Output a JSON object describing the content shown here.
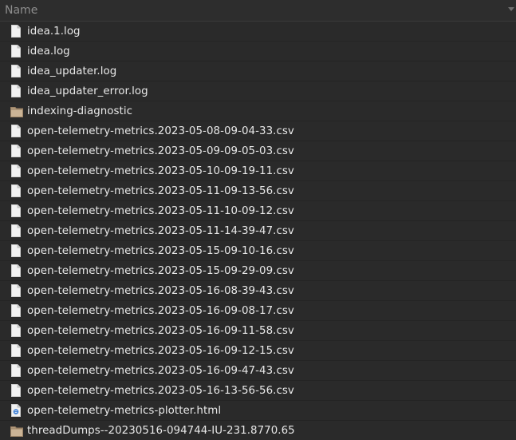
{
  "header": {
    "name_label": "Name"
  },
  "files": [
    {
      "name": "idea.1.log",
      "icon": "file-icon"
    },
    {
      "name": "idea.log",
      "icon": "file-icon"
    },
    {
      "name": "idea_updater.log",
      "icon": "file-icon"
    },
    {
      "name": "idea_updater_error.log",
      "icon": "file-icon"
    },
    {
      "name": "indexing-diagnostic",
      "icon": "folder-icon"
    },
    {
      "name": "open-telemetry-metrics.2023-05-08-09-04-33.csv",
      "icon": "file-icon"
    },
    {
      "name": "open-telemetry-metrics.2023-05-09-09-05-03.csv",
      "icon": "file-icon"
    },
    {
      "name": "open-telemetry-metrics.2023-05-10-09-19-11.csv",
      "icon": "file-icon"
    },
    {
      "name": "open-telemetry-metrics.2023-05-11-09-13-56.csv",
      "icon": "file-icon"
    },
    {
      "name": "open-telemetry-metrics.2023-05-11-10-09-12.csv",
      "icon": "file-icon"
    },
    {
      "name": "open-telemetry-metrics.2023-05-11-14-39-47.csv",
      "icon": "file-icon"
    },
    {
      "name": "open-telemetry-metrics.2023-05-15-09-10-16.csv",
      "icon": "file-icon"
    },
    {
      "name": "open-telemetry-metrics.2023-05-15-09-29-09.csv",
      "icon": "file-icon"
    },
    {
      "name": "open-telemetry-metrics.2023-05-16-08-39-43.csv",
      "icon": "file-icon"
    },
    {
      "name": "open-telemetry-metrics.2023-05-16-09-08-17.csv",
      "icon": "file-icon"
    },
    {
      "name": "open-telemetry-metrics.2023-05-16-09-11-58.csv",
      "icon": "file-icon"
    },
    {
      "name": "open-telemetry-metrics.2023-05-16-09-12-15.csv",
      "icon": "file-icon"
    },
    {
      "name": "open-telemetry-metrics.2023-05-16-09-47-43.csv",
      "icon": "file-icon"
    },
    {
      "name": "open-telemetry-metrics.2023-05-16-13-56-56.csv",
      "icon": "file-icon"
    },
    {
      "name": "open-telemetry-metrics-plotter.html",
      "icon": "html-file-icon"
    },
    {
      "name": "threadDumps--20230516-094744-IU-231.8770.65",
      "icon": "folder-icon"
    }
  ]
}
